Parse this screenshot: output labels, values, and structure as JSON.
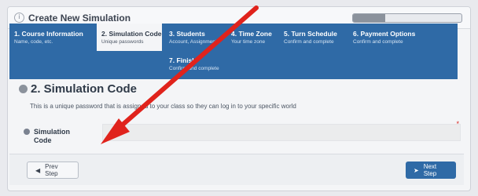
{
  "header": {
    "title": "Create New Simulation",
    "progress_fraction": 0.3
  },
  "steps": [
    {
      "name": "1. Course Information",
      "desc": "Name, code, etc."
    },
    {
      "name": "2. Simulation Code",
      "desc": "Unique passwords"
    },
    {
      "name": "3. Students",
      "desc": "Account, Assignment"
    },
    {
      "name": "4. Time Zone",
      "desc": "Your time zone"
    },
    {
      "name": "5. Turn Schedule",
      "desc": "Confirm and complete"
    },
    {
      "name": "6. Payment Options",
      "desc": "Confirm and complete"
    },
    {
      "name": "7. Finish",
      "desc": "Confirm and complete"
    }
  ],
  "section": {
    "title": "2. Simulation Code",
    "description": "This is a unique password that is assigned to your class so they can log in to your specific world"
  },
  "field": {
    "label": "Simulation Code",
    "value": "",
    "required_mark": "*"
  },
  "footer": {
    "prev_label": "Prev Step",
    "next_label": "Next Step"
  },
  "colors": {
    "accent": "#2f6aa6",
    "arrow": "#e0231c"
  }
}
